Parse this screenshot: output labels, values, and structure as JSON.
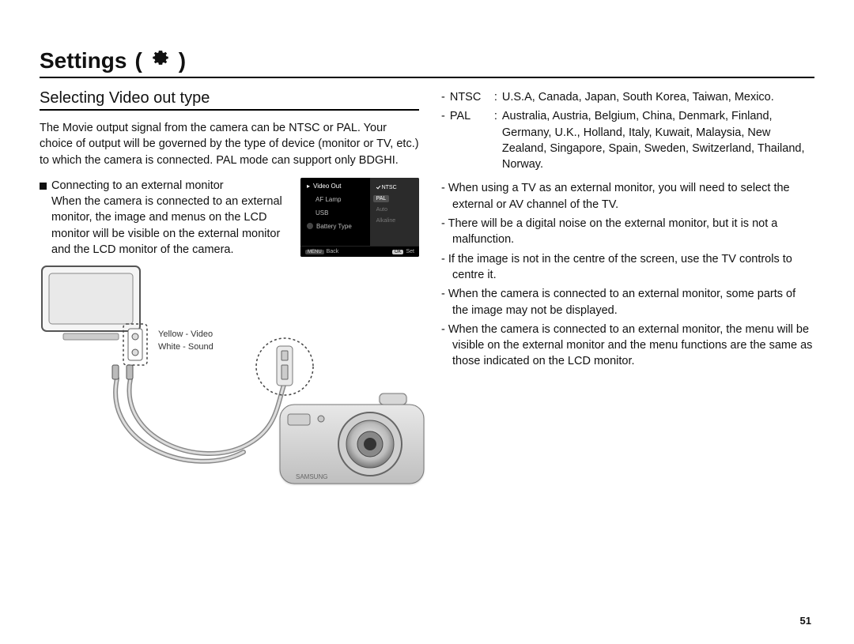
{
  "header": {
    "title_prefix": "Settings",
    "title_open": "(",
    "title_close": ")"
  },
  "left": {
    "subhead": "Selecting Video out type",
    "intro": "The Movie output signal from the camera can be NTSC or PAL. Your choice of output will be governed by the type of device (monitor or TV, etc.) to which the camera is connected. PAL mode can support only BDGHI.",
    "connect_heading": "Connecting to an external monitor",
    "connect_body": "When the camera is connected to an external monitor, the image and menus on the LCD monitor will be visible on the external monitor and the LCD monitor of the camera.",
    "legend_line1": "Yellow - Video",
    "legend_line2": "White - Sound"
  },
  "menu": {
    "items": [
      "Video Out",
      "AF Lamp",
      "USB",
      "Battery Type"
    ],
    "options": [
      "NTSC",
      "PAL",
      "Auto",
      "Alkaline"
    ],
    "foot_left": "Back",
    "foot_left_badge": "MENU",
    "foot_right": "Set",
    "foot_right_badge": "OK"
  },
  "right": {
    "ntsc_label": "NTSC",
    "ntsc_colon": ":",
    "ntsc_text": "U.S.A, Canada, Japan, South Korea, Taiwan, Mexico.",
    "pal_label": "PAL",
    "pal_colon": ":",
    "pal_text": "Australia, Austria, Belgium, China, Denmark, Finland, Germany, U.K., Holland, Italy, Kuwait, Malaysia, New Zealand, Singapore, Spain, Sweden, Switzerland, Thailand, Norway.",
    "bullets": [
      "When using a TV as an external monitor, you will need to select the external or AV channel of the TV.",
      "There will be a digital noise on the external monitor, but it is not a malfunction.",
      "If the image is not in the centre of the screen, use the TV controls to centre it.",
      "When the camera is connected to an external monitor, some parts of the image may not be displayed.",
      "When the camera is connected to an external monitor, the menu will be visible on the external monitor and the menu functions are the same as those indicated on the LCD monitor."
    ]
  },
  "page_number": "51"
}
